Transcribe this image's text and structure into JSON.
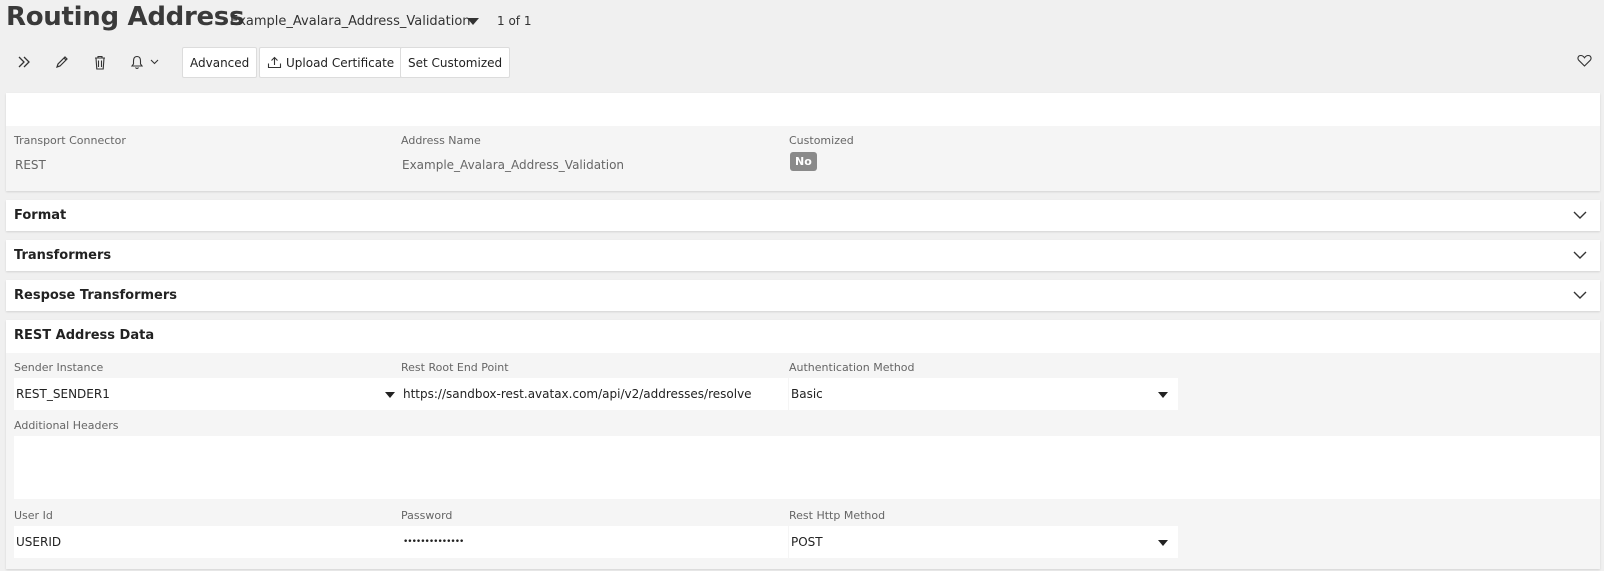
{
  "header": {
    "title": "Routing Address",
    "record_name": "Example_Avalara_Address_Validation",
    "record_count": "1 of 1"
  },
  "toolbar": {
    "advanced_label": "Advanced",
    "upload_certificate_label": "Upload Certificate",
    "set_customized_label": "Set Customized"
  },
  "summary": {
    "transport_connector_label": "Transport Connector",
    "transport_connector_value": "REST",
    "address_name_label": "Address Name",
    "address_name_value": "Example_Avalara_Address_Validation",
    "customized_label": "Customized",
    "customized_value": "No"
  },
  "sections": {
    "format": "Format",
    "transformers": "Transformers",
    "response_transformers": "Respose Transformers",
    "rest_address_data": "REST Address Data"
  },
  "rest": {
    "sender_instance_label": "Sender Instance",
    "sender_instance_value": "REST_SENDER1",
    "root_endpoint_label": "Rest Root End Point",
    "root_endpoint_value": "https://sandbox-rest.avatax.com/api/v2/addresses/resolve",
    "auth_method_label": "Authentication Method",
    "auth_method_value": "Basic",
    "additional_headers_label": "Additional Headers",
    "additional_headers_value": "",
    "user_id_label": "User Id",
    "user_id_value": "USERID",
    "password_label": "Password",
    "password_value": "••••••••••••••",
    "http_method_label": "Rest Http Method",
    "http_method_value": "POST"
  },
  "icons": {
    "expand": "double-chevron-right-icon",
    "edit": "pencil-icon",
    "delete": "trash-icon",
    "notify": "bell-icon",
    "upload": "upload-icon",
    "favorite": "heart-icon"
  }
}
